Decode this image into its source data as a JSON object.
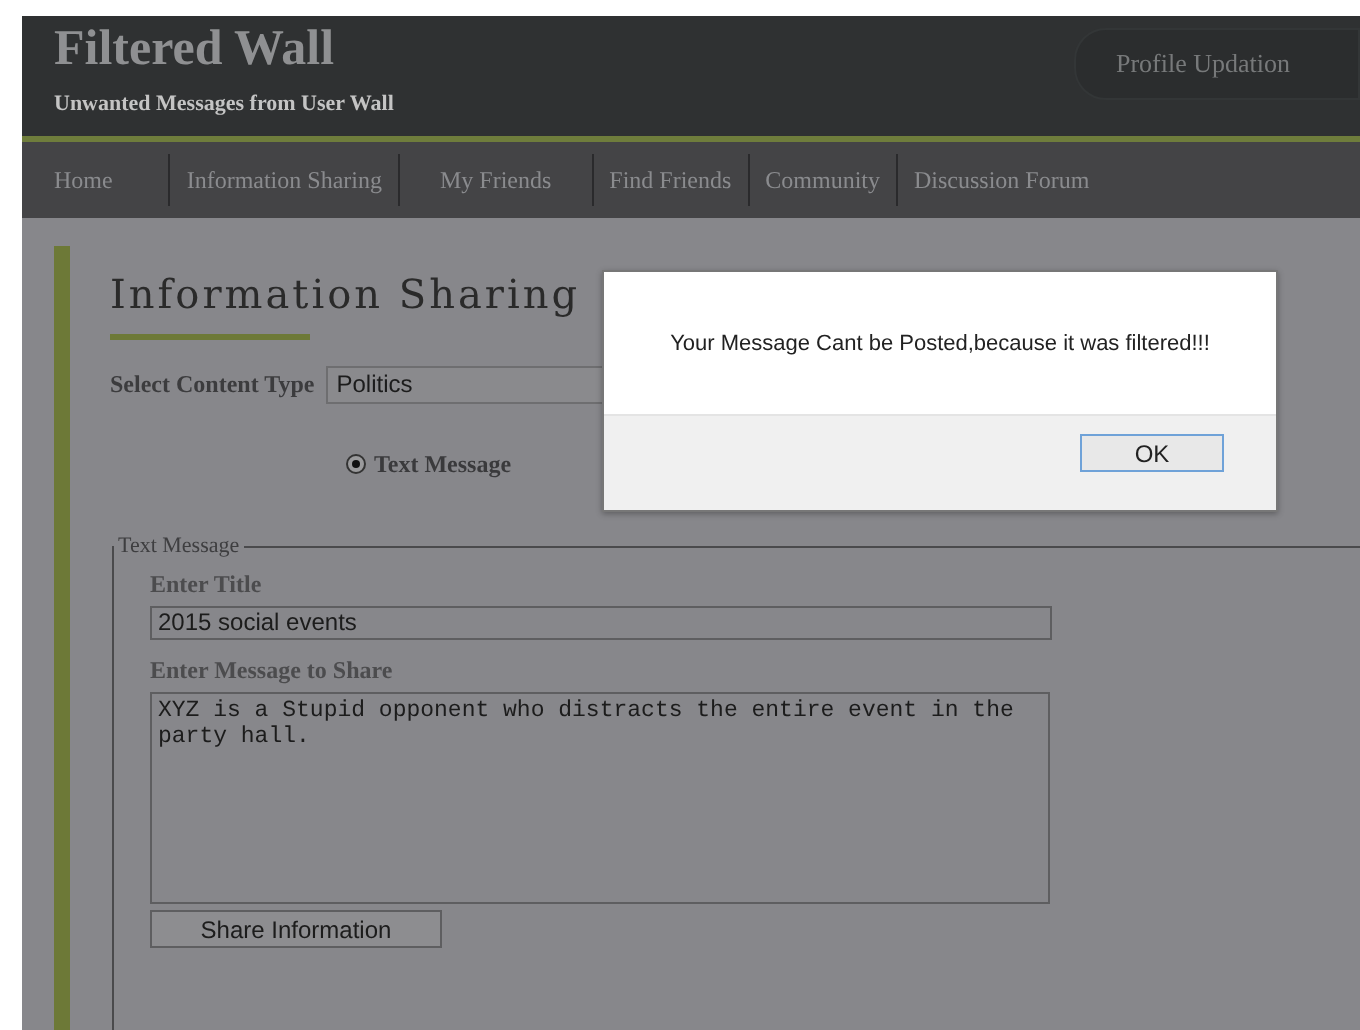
{
  "header": {
    "title": "Filtered Wall",
    "subtitle": "Unwanted Messages from User Wall",
    "profile_button": "Profile Updation"
  },
  "nav": [
    {
      "label": "Home"
    },
    {
      "label": "Information Sharing"
    },
    {
      "label": "My Friends"
    },
    {
      "label": "Find Friends"
    },
    {
      "label": "Community"
    },
    {
      "label": "Discussion Forum"
    }
  ],
  "page": {
    "heading": "Information Sharing",
    "content_type": {
      "label": "Select Content Type",
      "value": "Politics"
    },
    "message_type": [
      {
        "label": "Text Message",
        "selected": true
      }
    ],
    "fieldset": {
      "legend": "Text Message",
      "title_label": "Enter Title",
      "title_value": "2015 social events",
      "message_label": "Enter Message to Share",
      "message_value": "XYZ is a Stupid opponent who distracts the entire event in the party hall.",
      "button": "Share Information"
    }
  },
  "dialog": {
    "message": "Your Message Cant be Posted,because it was filtered!!!",
    "button": "OK"
  }
}
